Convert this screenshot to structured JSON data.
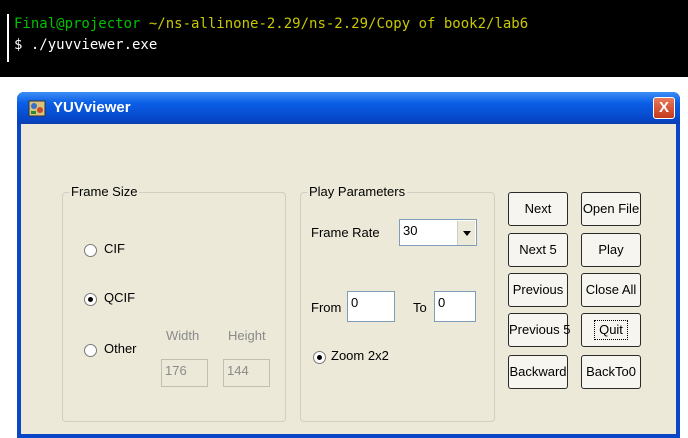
{
  "terminal": {
    "user_host": "Final@projector",
    "path": "~/ns-allinone-2.29/ns-2.29/Copy of book2/lab6",
    "command": "$ ./yuvviewer.exe"
  },
  "window": {
    "title": "YUVviewer",
    "close_glyph": "X"
  },
  "frame_size": {
    "title": "Frame Size",
    "options": [
      {
        "label": "CIF",
        "selected": false
      },
      {
        "label": "QCIF",
        "selected": true
      },
      {
        "label": "Other",
        "selected": false
      }
    ],
    "width_label": "Width",
    "height_label": "Height",
    "width_value": "176",
    "height_value": "144"
  },
  "play_parameters": {
    "title": "Play Parameters",
    "frame_rate_label": "Frame Rate",
    "frame_rate_value": "30",
    "from_label": "From",
    "from_value": "0",
    "to_label": "To",
    "to_value": "0",
    "zoom_label": "Zoom 2x2",
    "zoom_selected": true
  },
  "buttons": {
    "next": "Next",
    "next5": "Next 5",
    "previous": "Previous",
    "previous5": "Previous 5",
    "backward": "Backward",
    "open_file": "Open File",
    "play": "Play",
    "close_all": "Close All",
    "quit": "Quit",
    "back_to_0": "BackTo0"
  },
  "colors": {
    "titlebar": "#0a5ee6",
    "dialog_bg": "#ece9d8",
    "terminal_green": "#00c000",
    "terminal_yellow": "#c8c800"
  }
}
